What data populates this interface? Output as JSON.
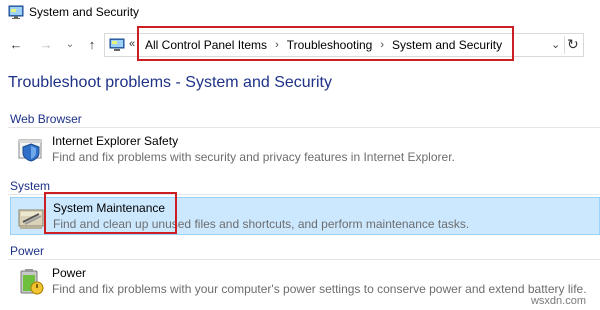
{
  "window": {
    "title": "System and Security",
    "icon": "control-panel-icon"
  },
  "nav": {
    "back_icon": "back-arrow-icon",
    "forward_icon": "forward-arrow-icon",
    "recent_icon": "recent-locations-chevron-icon",
    "up_icon": "up-arrow-icon",
    "back_glyph": "←",
    "forward_glyph": "→",
    "recent_glyph": "⌄",
    "up_glyph": "↑"
  },
  "address_bar": {
    "overflow_glyph": "«",
    "separator": "›",
    "breadcrumbs": [
      "All Control Panel Items",
      "Troubleshooting",
      "System and Security"
    ],
    "dropdown_glyph": "⌄",
    "refresh_glyph": "↻"
  },
  "page": {
    "title": "Troubleshoot problems - System and Security"
  },
  "groups": [
    {
      "header": "Web Browser",
      "items": [
        {
          "name": "Internet Explorer Safety",
          "description": "Find and fix problems with security and privacy features in Internet Explorer.",
          "icon": "shield-browser-icon",
          "selected": false
        }
      ]
    },
    {
      "header": "System",
      "items": [
        {
          "name": "System Maintenance",
          "description": "Find and clean up unused files and shortcuts, and perform maintenance tasks.",
          "icon": "maintenance-tools-icon",
          "selected": true
        }
      ]
    },
    {
      "header": "Power",
      "items": [
        {
          "name": "Power",
          "description": "Find and fix problems with your computer's power settings to conserve power and extend battery life.",
          "icon": "power-battery-icon",
          "selected": false
        }
      ]
    }
  ],
  "watermark": "wsxdn.com",
  "colors": {
    "link_blue": "#1e3287",
    "highlight_red": "#cc1f25",
    "selection_bg": "#cce8ff",
    "selection_border": "#99d1ff",
    "description_gray": "#6d6d6d"
  }
}
